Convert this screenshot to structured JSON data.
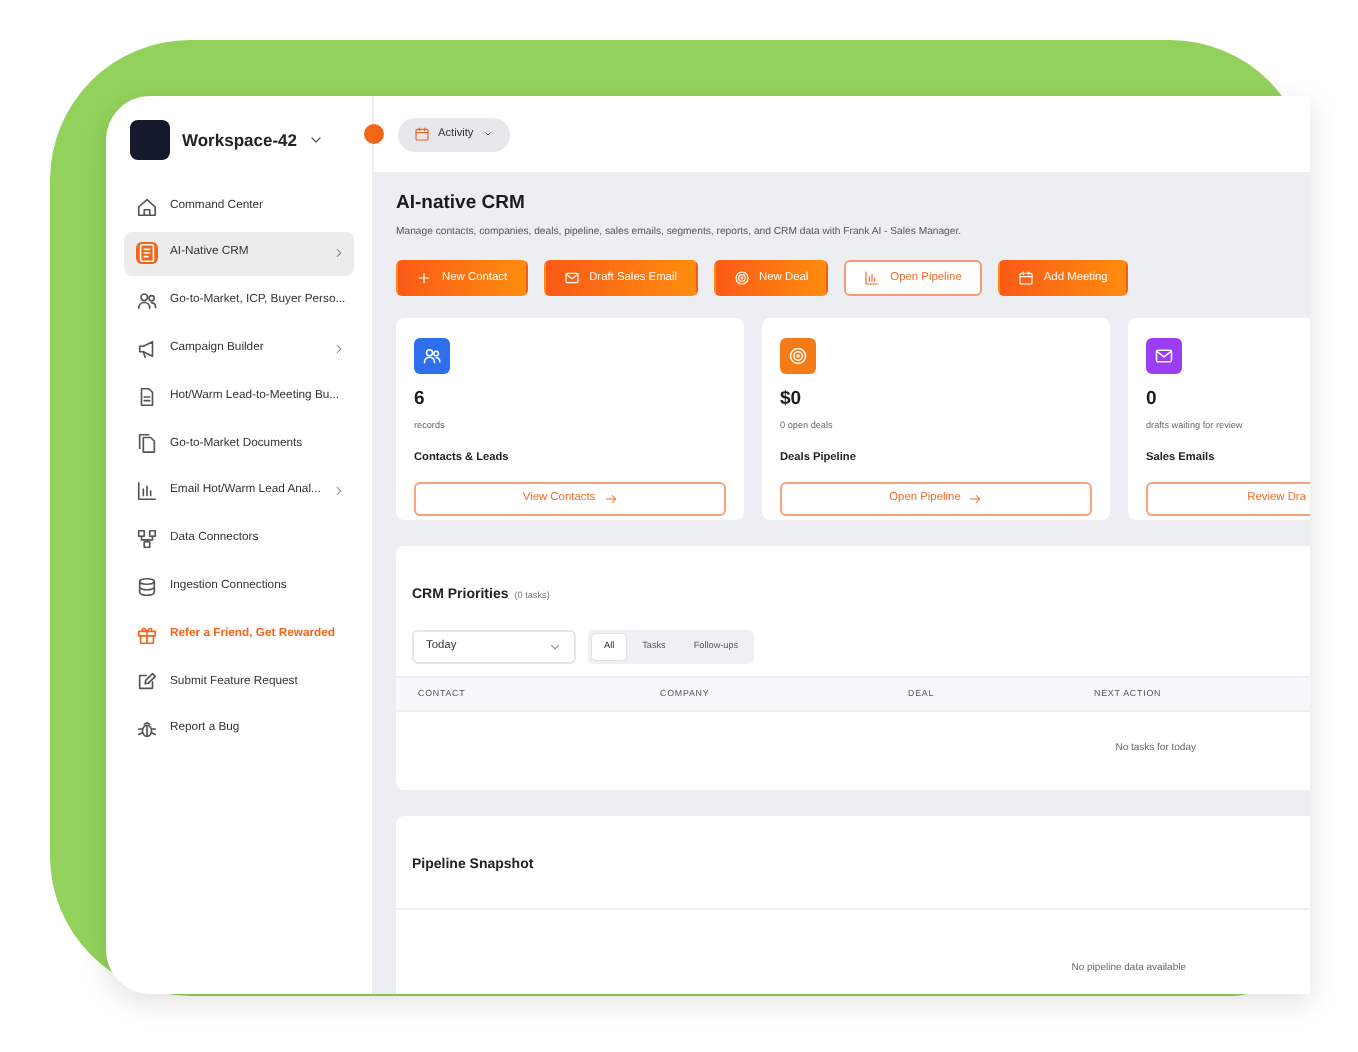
{
  "workspace": {
    "name": "Workspace-42"
  },
  "activity_menu": {
    "label": "Activity"
  },
  "sidebar": {
    "items": [
      {
        "label": "Command Center",
        "selected": false,
        "has_submenu": false,
        "kind": "link"
      },
      {
        "label": "AI-Native CRM",
        "selected": true,
        "has_submenu": true,
        "kind": "link"
      },
      {
        "label": "Go-to-Market, ICP, Buyer Perso...",
        "selected": false,
        "has_submenu": false,
        "kind": "link"
      },
      {
        "label": "Campaign Builder",
        "selected": false,
        "has_submenu": true,
        "kind": "link"
      },
      {
        "label": "Hot/Warm Lead-to-Meeting Bu...",
        "selected": false,
        "has_submenu": false,
        "kind": "link"
      },
      {
        "label": "Go-to-Market Documents",
        "selected": false,
        "has_submenu": false,
        "kind": "link"
      },
      {
        "label": "Email Hot/Warm Lead Anal...",
        "selected": false,
        "has_submenu": true,
        "kind": "link"
      },
      {
        "label": "Data Connectors",
        "selected": false,
        "has_submenu": false,
        "kind": "link"
      },
      {
        "label": "Ingestion Connections",
        "selected": false,
        "has_submenu": false,
        "kind": "link"
      },
      {
        "label": "Refer a Friend, Get Rewarded",
        "selected": false,
        "has_submenu": false,
        "kind": "promo"
      },
      {
        "label": "Submit Feature Request",
        "selected": false,
        "has_submenu": false,
        "kind": "link"
      },
      {
        "label": "Report a Bug",
        "selected": false,
        "has_submenu": false,
        "kind": "link"
      }
    ]
  },
  "page": {
    "title": "AI-native CRM",
    "description": "Manage contacts, companies, deals, pipeline, sales emails, segments, reports, and CRM data with Frank AI - Sales Manager."
  },
  "actions": [
    {
      "label": "New Contact",
      "kind": "primary"
    },
    {
      "label": "Draft Sales Email",
      "kind": "primary"
    },
    {
      "label": "New Deal",
      "kind": "primary"
    },
    {
      "label": "Open Pipeline",
      "kind": "outline"
    },
    {
      "label": "Add Meeting",
      "kind": "primary"
    }
  ],
  "stat_cards": [
    {
      "value": "6",
      "caption": "records",
      "title": "Contacts & Leads",
      "button": "View Contacts",
      "color": "#2f6fed"
    },
    {
      "value": "$0",
      "caption": "0 open deals",
      "title": "Deals Pipeline",
      "button": "Open Pipeline",
      "color": "#f47b16"
    },
    {
      "value": "0",
      "caption": "drafts waiting for review",
      "title": "Sales Emails",
      "button": "Review Dra",
      "color": "#9b3df0"
    }
  ],
  "priorities": {
    "title": "CRM Priorities",
    "count": "(0 tasks)",
    "period": "Today",
    "filters": [
      {
        "label": "All",
        "selected": true
      },
      {
        "label": "Tasks",
        "selected": false
      },
      {
        "label": "Follow-ups",
        "selected": false
      }
    ],
    "columns": [
      "CONTACT",
      "COMPANY",
      "DEAL",
      "NEXT ACTION"
    ],
    "empty_text": "No tasks for today"
  },
  "pipeline": {
    "title": "Pipeline Snapshot",
    "empty_text": "No pipeline data available"
  }
}
